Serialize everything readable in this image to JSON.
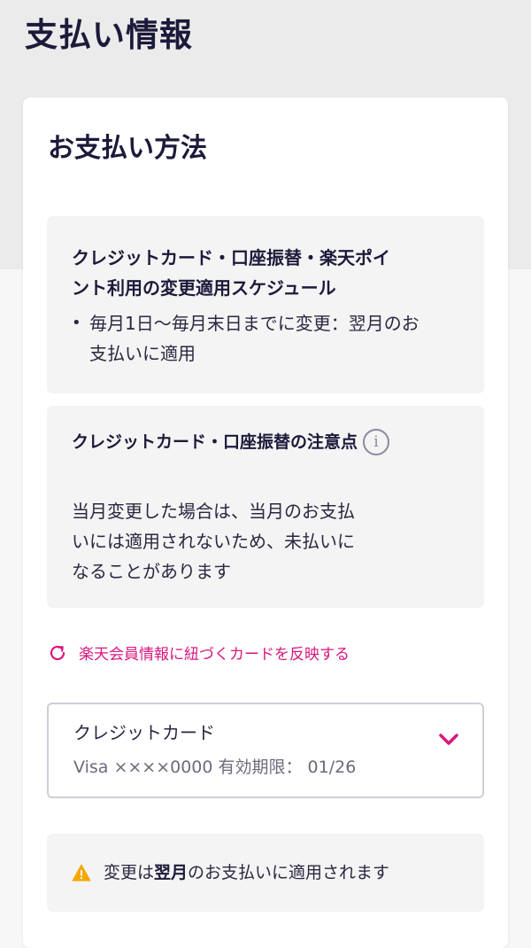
{
  "page": {
    "title": "支払い情報"
  },
  "payment": {
    "title": "お支払い方法",
    "schedule": {
      "heading_line1": "クレジットカード・口座振替・楽天ポイ",
      "heading_line2": "ント利用の変更適用スケジュール",
      "items": [
        {
          "line1": "毎月1日〜毎月末日までに変更：翌月のお",
          "line2": "支払いに適用"
        }
      ]
    },
    "notes": {
      "heading": "クレジットカード・口座振替の注意点",
      "info_icon_text": "i",
      "body_line1": "当月変更した場合は、当月のお支払",
      "body_line2": "いには適用されないため、未払いに",
      "body_line3": "なることがあります"
    },
    "sync_link": {
      "label": "楽天会員情報に紐づくカードを反映する",
      "icon": "refresh-icon"
    },
    "selected_method": {
      "label": "クレジットカード",
      "card_detail": "Visa ××××0000 有効期限： 01/26",
      "icon": "chevron-down-icon"
    },
    "notice": {
      "prefix": "変更は",
      "emphasis": "翌月",
      "suffix": "のお支払いに適用されます",
      "icon": "warning-icon"
    }
  },
  "colors": {
    "accent_pink": "#d9167f",
    "heading_navy": "#1c1a3a",
    "warning_yellow": "#f5a700",
    "muted_gray": "#6b6b7a"
  }
}
